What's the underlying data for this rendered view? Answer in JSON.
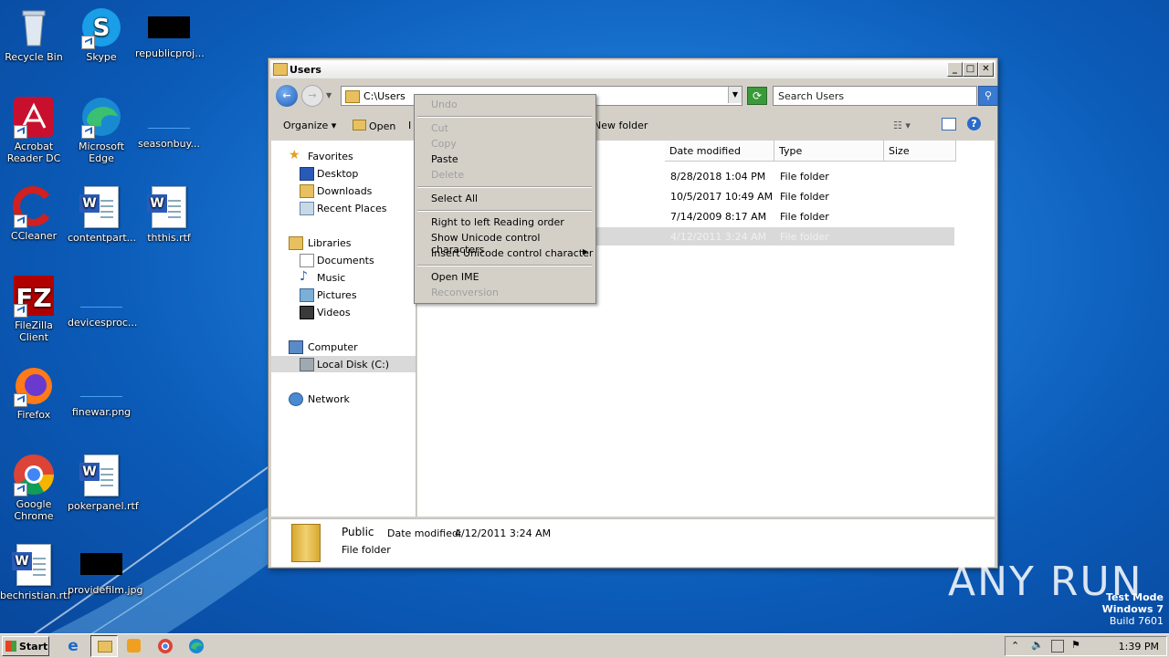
{
  "desktop": {
    "icons": [
      {
        "label": "Recycle Bin"
      },
      {
        "label": "Skype"
      },
      {
        "label": "republicproj..."
      },
      {
        "label": "Acrobat Reader DC"
      },
      {
        "label": "Microsoft Edge"
      },
      {
        "label": "seasonbuy..."
      },
      {
        "label": "CCleaner"
      },
      {
        "label": "contentpart..."
      },
      {
        "label": "ththis.rtf"
      },
      {
        "label": "FileZilla Client"
      },
      {
        "label": "devicesproc..."
      },
      {
        "label": "Firefox"
      },
      {
        "label": "finewar.png"
      },
      {
        "label": "Google Chrome"
      },
      {
        "label": "pokerpanel.rtf"
      },
      {
        "label": "bechristian.rtf"
      },
      {
        "label": "providefilm.jpg"
      }
    ]
  },
  "window": {
    "title": "Users",
    "address": "C:\\Users",
    "search_placeholder": "Search Users",
    "commands": {
      "organize": "Organize",
      "open": "Open",
      "include": "I",
      "new_folder": "New folder"
    },
    "nav": {
      "favorites": "Favorites",
      "desktop": "Desktop",
      "downloads": "Downloads",
      "recent_places": "Recent Places",
      "libraries": "Libraries",
      "documents": "Documents",
      "music": "Music",
      "pictures": "Pictures",
      "videos": "Videos",
      "computer": "Computer",
      "local_disk": "Local Disk (C:)",
      "network": "Network"
    },
    "columns": {
      "date_modified": "Date modified",
      "type": "Type",
      "size": "Size"
    },
    "rows": [
      {
        "date": "8/28/2018 1:04 PM",
        "type": "File folder"
      },
      {
        "date": "10/5/2017 10:49 AM",
        "type": "File folder"
      },
      {
        "date": "7/14/2009 8:17 AM",
        "type": "File folder"
      },
      {
        "date": "4/12/2011 3:24 AM",
        "type": "File folder"
      }
    ],
    "details": {
      "name": "Public",
      "date_label": "Date modified:",
      "date_value": "4/12/2011 3:24 AM",
      "type": "File folder"
    }
  },
  "context_menu": {
    "undo": "Undo",
    "cut": "Cut",
    "copy": "Copy",
    "paste": "Paste",
    "delete": "Delete",
    "select_all": "Select All",
    "rtl": "Right to left Reading order",
    "show_unicode": "Show Unicode control characters",
    "insert_unicode": "Insert Unicode control character",
    "open_ime": "Open IME",
    "reconversion": "Reconversion"
  },
  "taskbar": {
    "start": "Start",
    "clock": "1:39 PM"
  },
  "watermark": {
    "line1": "Test Mode",
    "line2": "Windows 7",
    "line3": "Build 7601",
    "brand": "ANY RUN"
  },
  "colors": {
    "desktop_blue": "#1c78d4",
    "window_face": "#d4d0c8",
    "selection_gray": "#d9d9d9"
  }
}
